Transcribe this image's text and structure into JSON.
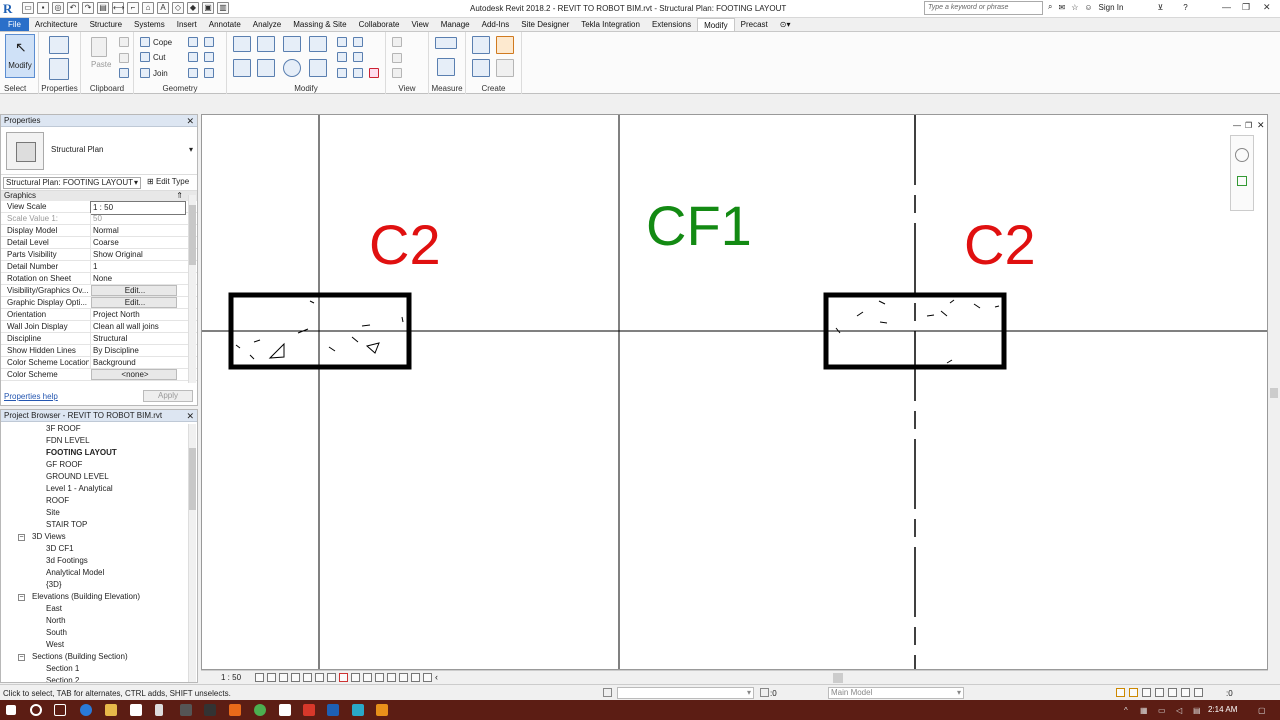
{
  "app": {
    "title": "Autodesk Revit 2018.2 -    REVIT TO ROBOT BIM.rvt - Structural Plan: FOOTING LAYOUT",
    "logo": "R",
    "search_placeholder": "Type a keyword or phrase",
    "sign_in": "Sign In",
    "help": "?"
  },
  "tabs": [
    "File",
    "Architecture",
    "Structure",
    "Systems",
    "Insert",
    "Annotate",
    "Analyze",
    "Massing & Site",
    "Collaborate",
    "View",
    "Manage",
    "Add-Ins",
    "Site Designer",
    "Tekla Integration",
    "Extensions",
    "Modify",
    "Precast"
  ],
  "active_tab": "Modify",
  "ribbon": {
    "modify_label": "Modify",
    "paste_label": "Paste",
    "cope_label": "Cope",
    "cut_label": "Cut",
    "join_label": "Join",
    "groups": [
      "Select",
      "Properties",
      "Clipboard",
      "Geometry",
      "Modify",
      "View",
      "Measure",
      "Create"
    ]
  },
  "properties": {
    "title": "Properties",
    "type_name": "Structural Plan",
    "instance_selector": "Structural Plan: FOOTING LAYOUT",
    "edit_type": "Edit Type",
    "category": "Graphics",
    "rows": [
      {
        "key": "View Scale",
        "value": "1 : 50"
      },
      {
        "key": "Scale Value    1:",
        "value": "50"
      },
      {
        "key": "Display Model",
        "value": "Normal"
      },
      {
        "key": "Detail Level",
        "value": "Coarse"
      },
      {
        "key": "Parts Visibility",
        "value": "Show Original"
      },
      {
        "key": "Detail Number",
        "value": "1"
      },
      {
        "key": "Rotation on Sheet",
        "value": "None"
      },
      {
        "key": "Visibility/Graphics Ov...",
        "value": "Edit..."
      },
      {
        "key": "Graphic Display Opti...",
        "value": "Edit..."
      },
      {
        "key": "Orientation",
        "value": "Project North"
      },
      {
        "key": "Wall Join Display",
        "value": "Clean all wall joins"
      },
      {
        "key": "Discipline",
        "value": "Structural"
      },
      {
        "key": "Show Hidden Lines",
        "value": "By Discipline"
      },
      {
        "key": "Color Scheme Location",
        "value": "Background"
      },
      {
        "key": "Color Scheme",
        "value": "<none>"
      }
    ],
    "help_link": "Properties help",
    "apply": "Apply"
  },
  "browser": {
    "title": "Project Browser - REVIT TO ROBOT BIM.rvt",
    "items": [
      {
        "label": "3F ROOF",
        "level": 2
      },
      {
        "label": "FDN LEVEL",
        "level": 2
      },
      {
        "label": "FOOTING LAYOUT",
        "level": 2,
        "bold": true
      },
      {
        "label": "GF ROOF",
        "level": 2
      },
      {
        "label": "GROUND LEVEL",
        "level": 2
      },
      {
        "label": "Level 1 - Analytical",
        "level": 2
      },
      {
        "label": "ROOF",
        "level": 2
      },
      {
        "label": "Site",
        "level": 2
      },
      {
        "label": "STAIR TOP",
        "level": 2
      },
      {
        "label": "3D Views",
        "level": 1
      },
      {
        "label": "3D CF1",
        "level": 2
      },
      {
        "label": "3d Footings",
        "level": 2
      },
      {
        "label": "Analytical Model",
        "level": 2
      },
      {
        "label": "{3D}",
        "level": 2
      },
      {
        "label": "Elevations (Building Elevation)",
        "level": 1
      },
      {
        "label": "East",
        "level": 2
      },
      {
        "label": "North",
        "level": 2
      },
      {
        "label": "South",
        "level": 2
      },
      {
        "label": "West",
        "level": 2
      },
      {
        "label": "Sections (Building Section)",
        "level": 1
      },
      {
        "label": "Section 1",
        "level": 2
      },
      {
        "label": "Section 2",
        "level": 2
      }
    ]
  },
  "canvas": {
    "label_c2_left": "C2",
    "label_cf1": "CF1",
    "label_c2_right": "C2",
    "colors": {
      "c2": "#e01010",
      "cf1": "#138a13"
    }
  },
  "viewbar": {
    "scale": "1 : 50"
  },
  "status": {
    "text": "Click to select, TAB for alternates, CTRL adds, SHIFT unselects.",
    "count": ":0",
    "model": "Main Model",
    "filter_count": ":0"
  },
  "taskbar": {
    "time": "2:14 AM"
  }
}
